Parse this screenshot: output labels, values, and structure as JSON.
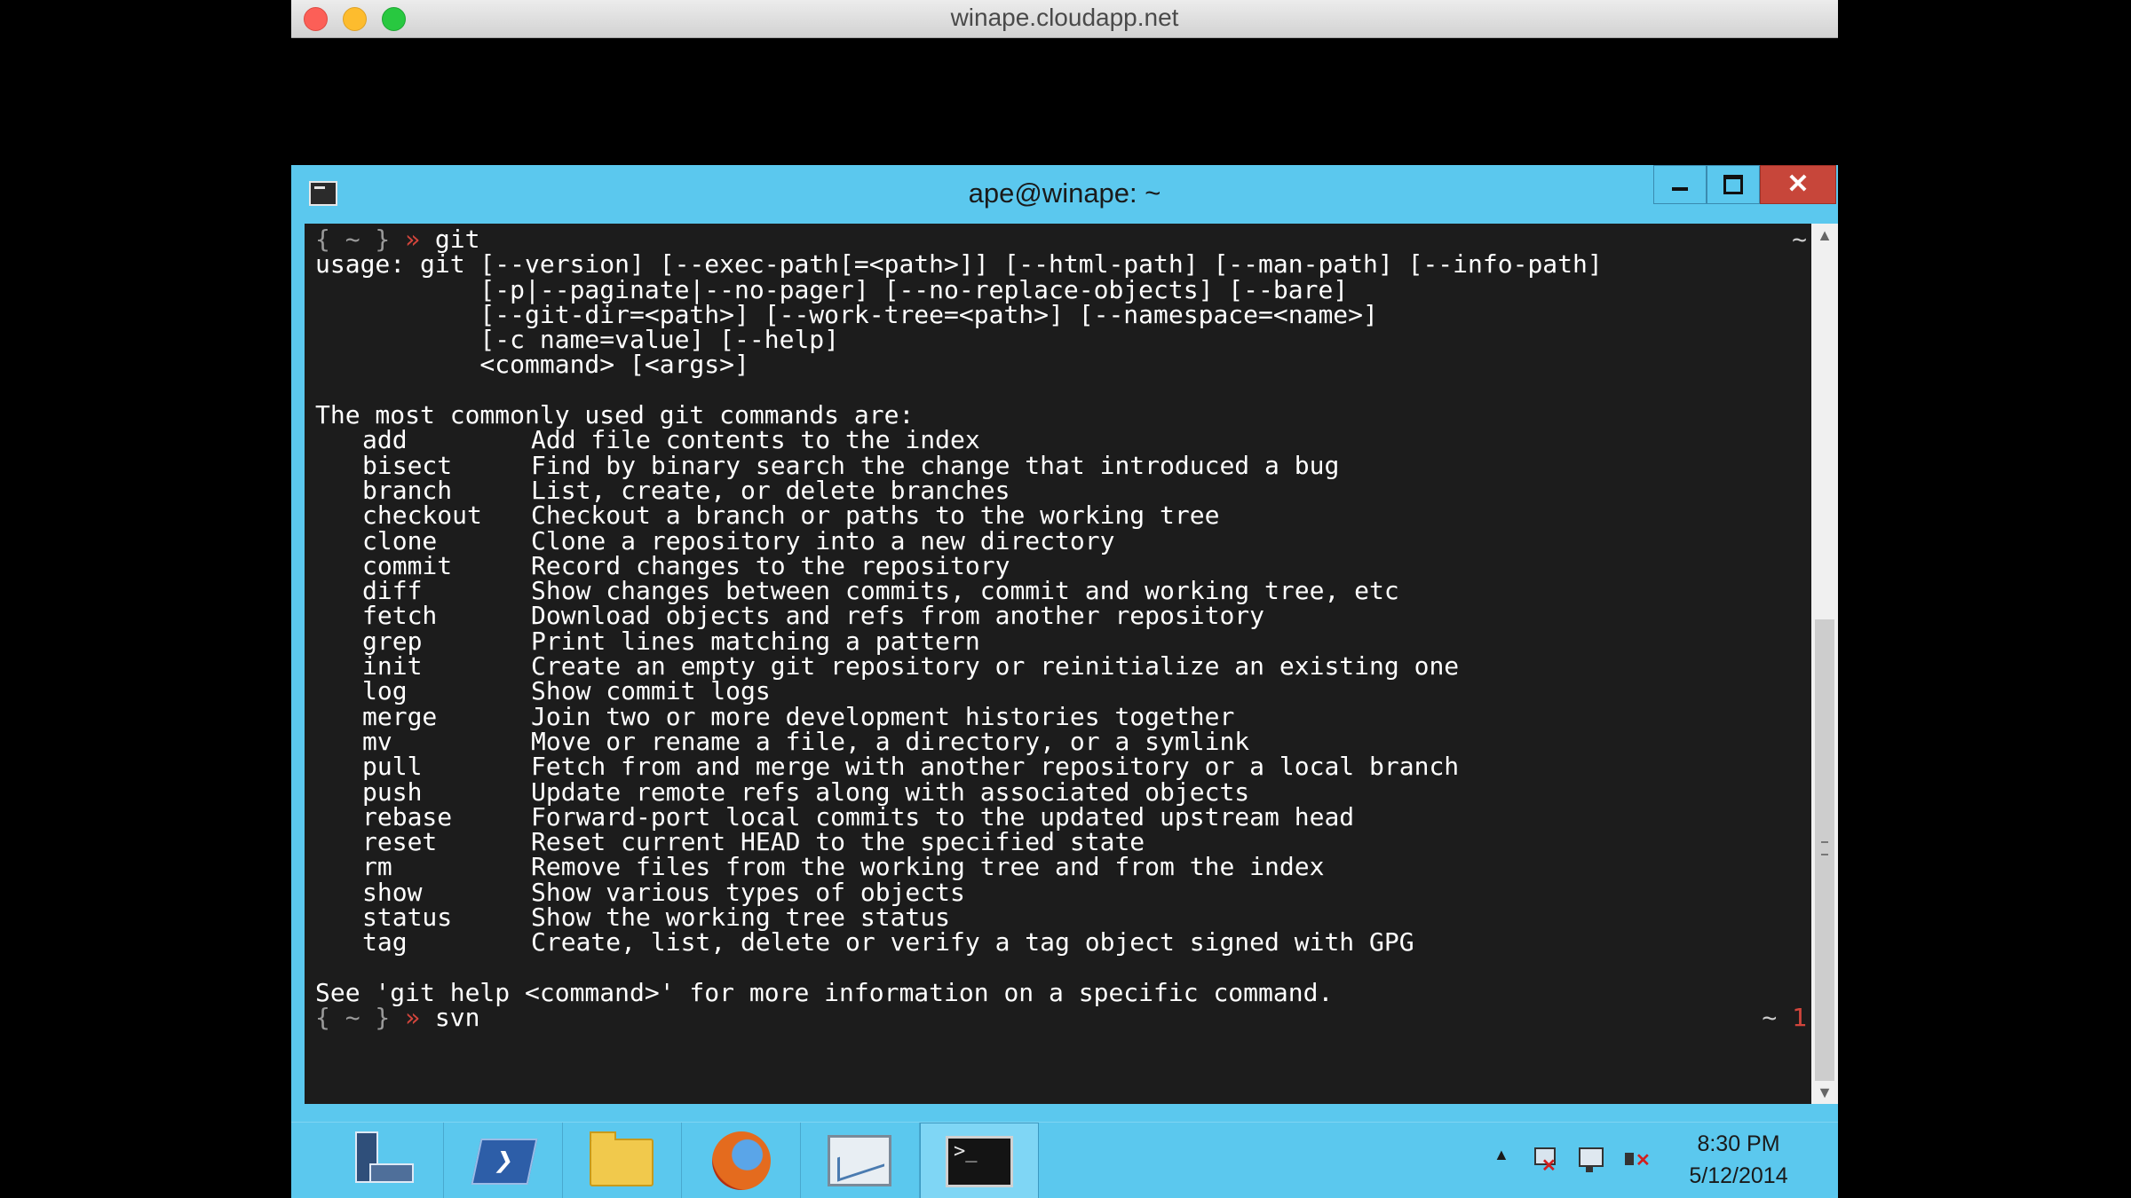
{
  "mac_window": {
    "title": "winape.cloudapp.net"
  },
  "console": {
    "title": "ape@winape: ~",
    "close_glyph": "✕"
  },
  "terminal": {
    "prompt": "{ ~ }",
    "prompt_arrow": "»",
    "first_command": "git",
    "first_right_mark": "~",
    "usage": [
      "usage: git [--version] [--exec-path[=<path>]] [--html-path] [--man-path] [--info-path]",
      "           [-p|--paginate|--no-pager] [--no-replace-objects] [--bare]",
      "           [--git-dir=<path>] [--work-tree=<path>] [--namespace=<name>]",
      "           [-c name=value] [--help]",
      "           <command> [<args>]"
    ],
    "commands_header": "The most commonly used git commands are:",
    "commands": [
      {
        "name": "add",
        "desc": "Add file contents to the index"
      },
      {
        "name": "bisect",
        "desc": "Find by binary search the change that introduced a bug"
      },
      {
        "name": "branch",
        "desc": "List, create, or delete branches"
      },
      {
        "name": "checkout",
        "desc": "Checkout a branch or paths to the working tree"
      },
      {
        "name": "clone",
        "desc": "Clone a repository into a new directory"
      },
      {
        "name": "commit",
        "desc": "Record changes to the repository"
      },
      {
        "name": "diff",
        "desc": "Show changes between commits, commit and working tree, etc"
      },
      {
        "name": "fetch",
        "desc": "Download objects and refs from another repository"
      },
      {
        "name": "grep",
        "desc": "Print lines matching a pattern"
      },
      {
        "name": "init",
        "desc": "Create an empty git repository or reinitialize an existing one"
      },
      {
        "name": "log",
        "desc": "Show commit logs"
      },
      {
        "name": "merge",
        "desc": "Join two or more development histories together"
      },
      {
        "name": "mv",
        "desc": "Move or rename a file, a directory, or a symlink"
      },
      {
        "name": "pull",
        "desc": "Fetch from and merge with another repository or a local branch"
      },
      {
        "name": "push",
        "desc": "Update remote refs along with associated objects"
      },
      {
        "name": "rebase",
        "desc": "Forward-port local commits to the updated upstream head"
      },
      {
        "name": "reset",
        "desc": "Reset current HEAD to the specified state"
      },
      {
        "name": "rm",
        "desc": "Remove files from the working tree and from the index"
      },
      {
        "name": "show",
        "desc": "Show various types of objects"
      },
      {
        "name": "status",
        "desc": "Show the working tree status"
      },
      {
        "name": "tag",
        "desc": "Create, list, delete or verify a tag object signed with GPG"
      }
    ],
    "help_footer": "See 'git help <command>' for more information on a specific command.",
    "second_command": "svn",
    "second_right_mark": "~",
    "exit_code": "1"
  },
  "taskbar": {
    "powershell_glyph": "❯",
    "console_glyph": ">_",
    "tray_arrow": "▲",
    "time": "8:30 PM",
    "date": "5/12/2014"
  },
  "scrollbar": {
    "up": "▲",
    "down": "▼"
  },
  "colors": {
    "console_chrome": "#5bc8ee",
    "terminal_bg": "#1c1c1c",
    "prompt_arrow": "#d2453c",
    "close_button": "#c7463a"
  }
}
